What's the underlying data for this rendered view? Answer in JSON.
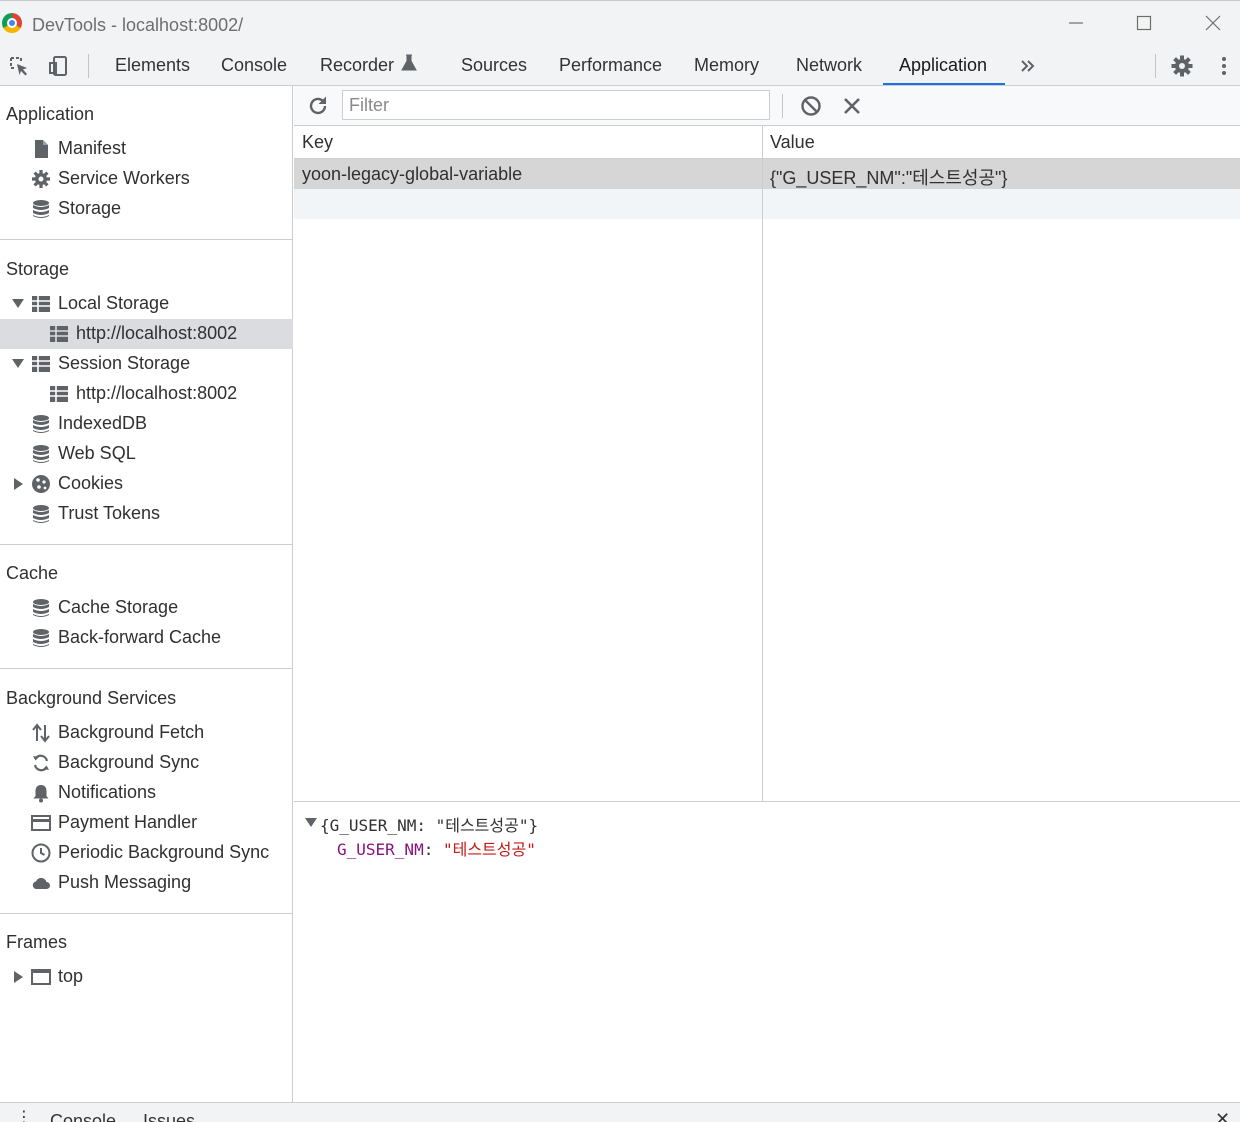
{
  "window": {
    "title": "DevTools - localhost:8002/"
  },
  "tabs": [
    {
      "label": "Elements"
    },
    {
      "label": "Console"
    },
    {
      "label": "Recorder"
    },
    {
      "label": "Sources"
    },
    {
      "label": "Performance"
    },
    {
      "label": "Memory"
    },
    {
      "label": "Network"
    },
    {
      "label": "Application",
      "active": true
    }
  ],
  "sidebar": {
    "application": {
      "title": "Application",
      "items": [
        {
          "label": "Manifest",
          "icon": "document-icon"
        },
        {
          "label": "Service Workers",
          "icon": "gear-icon"
        },
        {
          "label": "Storage",
          "icon": "database-icon"
        }
      ]
    },
    "storage": {
      "title": "Storage",
      "local_storage": "Local Storage",
      "local_origin": "http://localhost:8002",
      "session_storage": "Session Storage",
      "session_origin": "http://localhost:8002",
      "indexeddb": "IndexedDB",
      "websql": "Web SQL",
      "cookies": "Cookies",
      "trust_tokens": "Trust Tokens"
    },
    "cache": {
      "title": "Cache",
      "cache_storage": "Cache Storage",
      "back_forward": "Back-forward Cache"
    },
    "background": {
      "title": "Background Services",
      "items": [
        {
          "label": "Background Fetch",
          "icon": "arrows-updown-icon"
        },
        {
          "label": "Background Sync",
          "icon": "sync-icon"
        },
        {
          "label": "Notifications",
          "icon": "bell-icon"
        },
        {
          "label": "Payment Handler",
          "icon": "card-icon"
        },
        {
          "label": "Periodic Background Sync",
          "icon": "clock-icon"
        },
        {
          "label": "Push Messaging",
          "icon": "cloud-icon"
        }
      ]
    },
    "frames": {
      "title": "Frames",
      "top": "top"
    }
  },
  "storage_view": {
    "filter_placeholder": "Filter",
    "columns": {
      "key": "Key",
      "value": "Value"
    },
    "rows": [
      {
        "key": "yoon-legacy-global-variable",
        "value": "{\"G_USER_NM\":\"테스트성공\"}"
      }
    ],
    "preview": {
      "summary_open": "{G_USER_NM: ",
      "summary_value": "\"테스트성공\"",
      "summary_close": "}",
      "prop_key": "G_USER_NM",
      "prop_sep": ": ",
      "prop_value": "\"테스트성공\""
    }
  },
  "drawer": {
    "console": "Console",
    "issues": "Issues"
  },
  "colors": {
    "accent": "#1a73e8",
    "selected_row": "#d6d6d6",
    "prop_key": "#881280",
    "string_value": "#c41a16"
  }
}
